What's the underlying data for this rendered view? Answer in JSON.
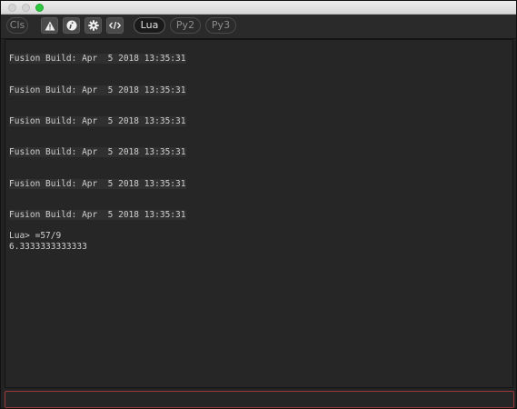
{
  "toolbar": {
    "cls_label": "Cls",
    "icons": [
      "warning-icon",
      "info-icon",
      "gear-icon",
      "code-icon"
    ],
    "lang_tabs": [
      {
        "label": "Lua",
        "active": true
      },
      {
        "label": "Py2",
        "active": false
      },
      {
        "label": "Py3",
        "active": false
      }
    ]
  },
  "console": {
    "build_lines": [
      "Fusion Build: Apr  5 2018 13:35:31",
      "Fusion Build: Apr  5 2018 13:35:31",
      "Fusion Build: Apr  5 2018 13:35:31",
      "Fusion Build: Apr  5 2018 13:35:31",
      "Fusion Build: Apr  5 2018 13:35:31",
      "Fusion Build: Apr  5 2018 13:35:31"
    ],
    "prompt_line": "Lua> =57/9",
    "result_line": "6.3333333333333"
  },
  "input": {
    "value": ""
  },
  "colors": {
    "input_border": "#9a3a3a",
    "maximize_button": "#2bc840"
  }
}
